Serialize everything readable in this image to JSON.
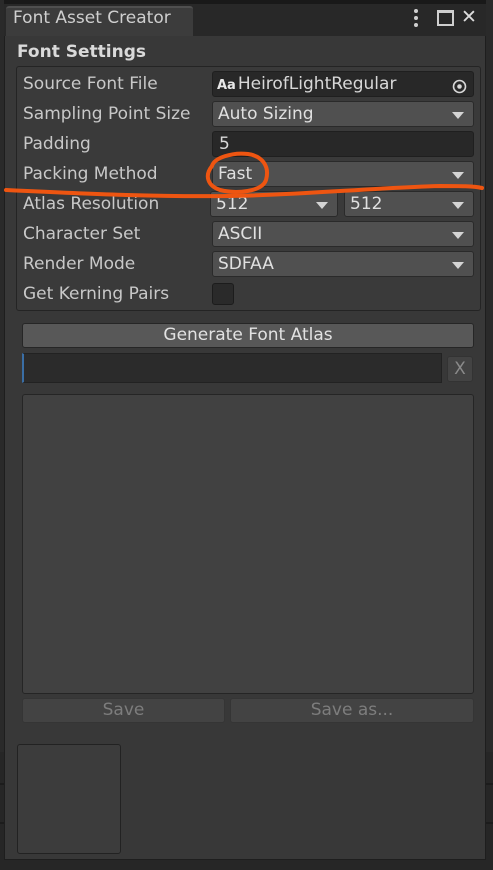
{
  "window": {
    "tab_title": "Font Asset Creator",
    "close_glyph": "✕"
  },
  "font_settings": {
    "section_title": "Font Settings",
    "source_font_file": {
      "label": "Source Font File",
      "value_icon_glyph": "Aa",
      "value": "HeirofLightRegular"
    },
    "sampling_point_size": {
      "label": "Sampling Point Size",
      "value": "Auto Sizing"
    },
    "padding": {
      "label": "Padding",
      "value": "5"
    },
    "packing_method": {
      "label": "Packing Method",
      "value": "Fast"
    },
    "atlas_resolution": {
      "label": "Atlas Resolution",
      "width": "512",
      "height": "512"
    },
    "character_set": {
      "label": "Character Set",
      "value": "ASCII"
    },
    "render_mode": {
      "label": "Render Mode",
      "value": "SDFAA"
    },
    "get_kerning_pairs": {
      "label": "Get Kerning Pairs",
      "checked": false
    }
  },
  "actions": {
    "generate_label": "Generate Font Atlas",
    "clear_label": "X",
    "save_label": "Save",
    "save_as_label": "Save as..."
  },
  "icons": {
    "object_picker": "circle-target-icon",
    "dropdown": "chevron-down-icon",
    "menu": "kebab-menu-icon",
    "maximize": "maximize-icon",
    "close": "close-icon",
    "font": "font-asset-icon"
  },
  "colors": {
    "annotation_stroke": "#ee5511",
    "panel_bg": "#383838",
    "field_bg": "#282828",
    "dropdown_bg": "#505050"
  }
}
